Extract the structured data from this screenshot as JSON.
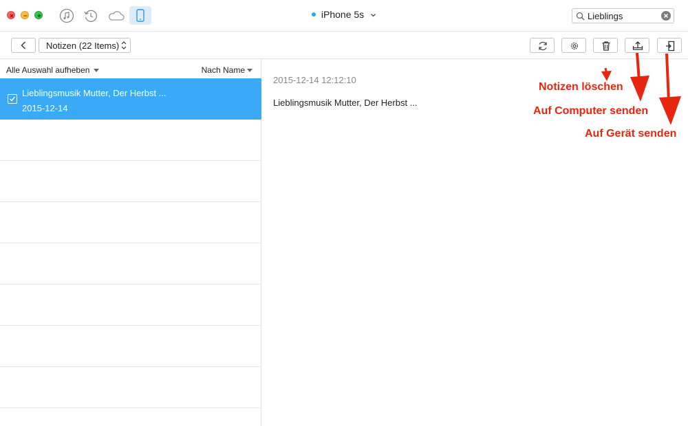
{
  "window": {
    "device_name": "iPhone 5s",
    "mode_icons": [
      "music-note-icon",
      "history-icon",
      "cloud-icon",
      "phone-icon"
    ]
  },
  "search": {
    "value": "Lieblings"
  },
  "toolbar": {
    "category_label": "Notizen (22 Items)",
    "actions": [
      "refresh-icon",
      "gear-icon",
      "trash-icon",
      "export-to-computer-icon",
      "import-to-device-icon"
    ]
  },
  "list": {
    "select_all_label": "Alle Auswahl aufheben",
    "sort_label": "Nach Name",
    "items": [
      {
        "title": "Lieblingsmusik Mutter, Der Herbst ...",
        "date": "2015-12-14",
        "selected": true
      }
    ]
  },
  "detail": {
    "timestamp": "2015-12-14 12:12:10",
    "text": "Lieblingsmusik Mutter, Der Herbst ..."
  },
  "annotations": {
    "delete": "Notizen löschen",
    "to_computer": "Auf Computer senden",
    "to_device": "Auf Gerät senden"
  },
  "colors": {
    "selection": "#3aa9f6",
    "annotation": "#e8260f",
    "device_dot": "#2aa7f2"
  }
}
